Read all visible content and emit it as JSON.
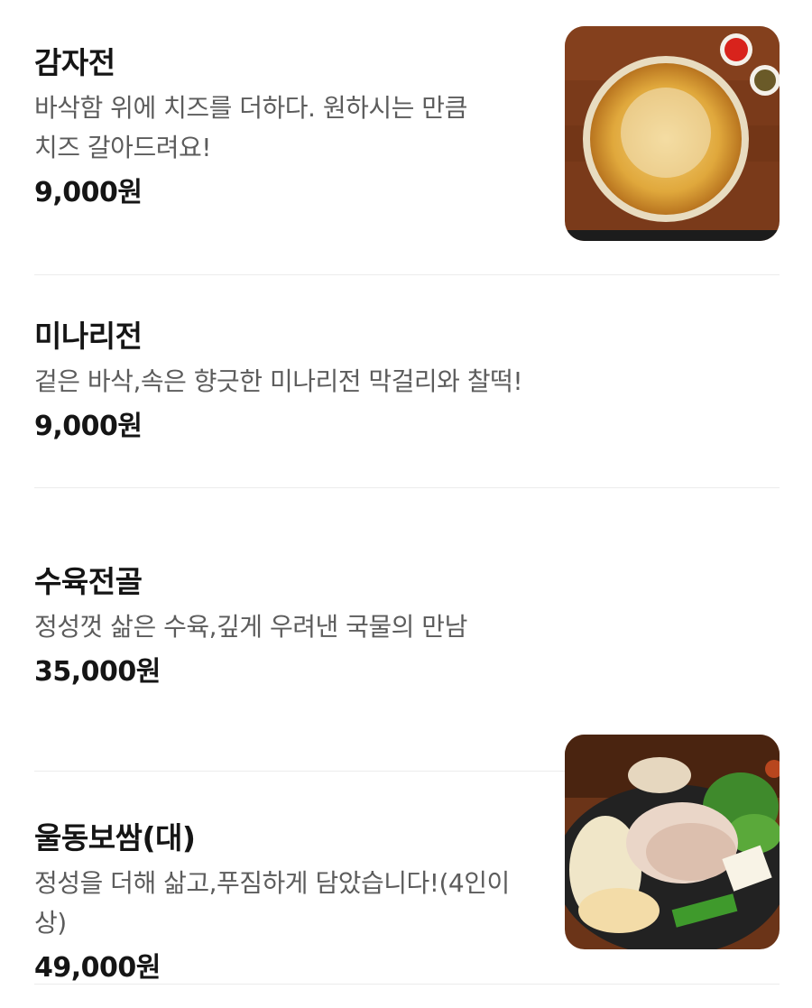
{
  "menu": {
    "items": [
      {
        "name": "감자전",
        "description": "바삭함 위에 치즈를 더하다. 원하시는 만큼\n치즈 갈아드려요!",
        "price": "9,000원",
        "image": "potato-pancake-photo"
      },
      {
        "name": "미나리전",
        "description": "겉은 바삭,속은 향긋한 미나리전 막걸리와 찰떡!",
        "price": "9,000원"
      },
      {
        "name": "수육전골",
        "description": "정성껏 삶은 수육,깊게 우려낸 국물의 만남",
        "price": "35,000원",
        "image": "suyuk-hotpot-photo"
      },
      {
        "name": "울동보쌈(대)",
        "description": "정성을 더해 삶고,푸짐하게 담았습니다!(4인이상)",
        "price": "49,000원"
      }
    ]
  }
}
